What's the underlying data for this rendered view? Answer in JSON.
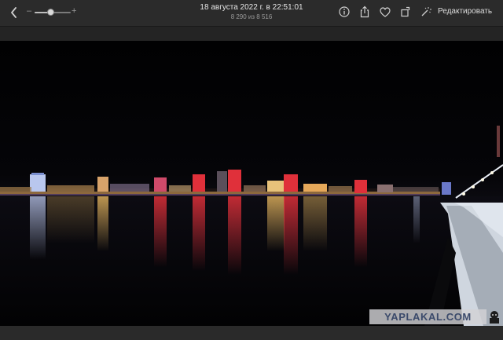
{
  "toolbar": {
    "back_icon": "chevron-left-icon",
    "zoom": {
      "minus_label": "–",
      "plus_label": "+",
      "level": 0.45
    },
    "title": "18 августа 2022 г. в 22:51:01",
    "subtitle": "8 290 из 8 516",
    "actions": [
      "info-icon",
      "share-icon",
      "heart-icon",
      "rotate-icon",
      "auto-enhance-icon"
    ],
    "edit_label": "Редактировать"
  },
  "photo": {
    "subject": "city-skyline-at-night-over-river"
  },
  "watermark": {
    "text": "YAPLAKAL.COM"
  },
  "colors": {
    "toolbar_bg": "#2b2b2b",
    "photo_bg": "#000000",
    "neon_red": "#e0303a"
  }
}
